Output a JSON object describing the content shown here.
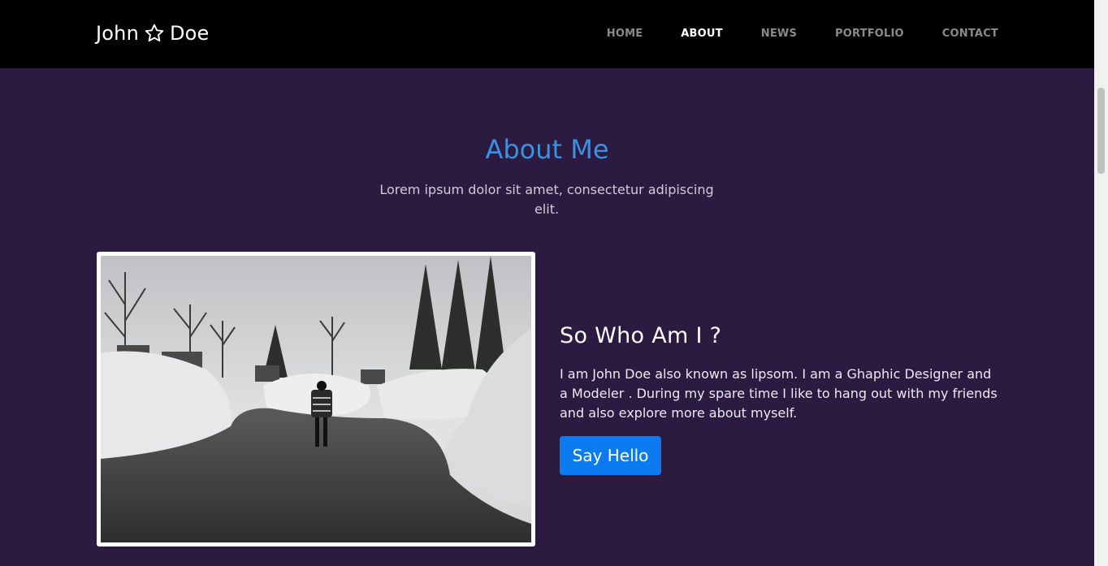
{
  "navbar": {
    "brand_first": "John",
    "brand_last": "Doe",
    "brand_icon": "star-outline-icon",
    "links": [
      {
        "label": "HOME",
        "active": false
      },
      {
        "label": "ABOUT",
        "active": true
      },
      {
        "label": "NEWS",
        "active": false
      },
      {
        "label": "PORTFOLIO",
        "active": false
      },
      {
        "label": "CONTACT",
        "active": false
      }
    ]
  },
  "about": {
    "title": "About Me",
    "subtitle": "Lorem ipsum dolor sit amet, consectetur adipiscing elit.",
    "heading": "So Who Am I ?",
    "text": "I am John Doe also known as lipsom. I am a Ghaphic Designer and a Modeler . During my spare time I like to hang out with my friends and also explore more about myself.",
    "button_label": "Say Hello"
  },
  "colors": {
    "background": "#2b1b40",
    "navbar": "#000000",
    "title_accent": "#3d8fe0",
    "button": "#0d7bf0"
  }
}
